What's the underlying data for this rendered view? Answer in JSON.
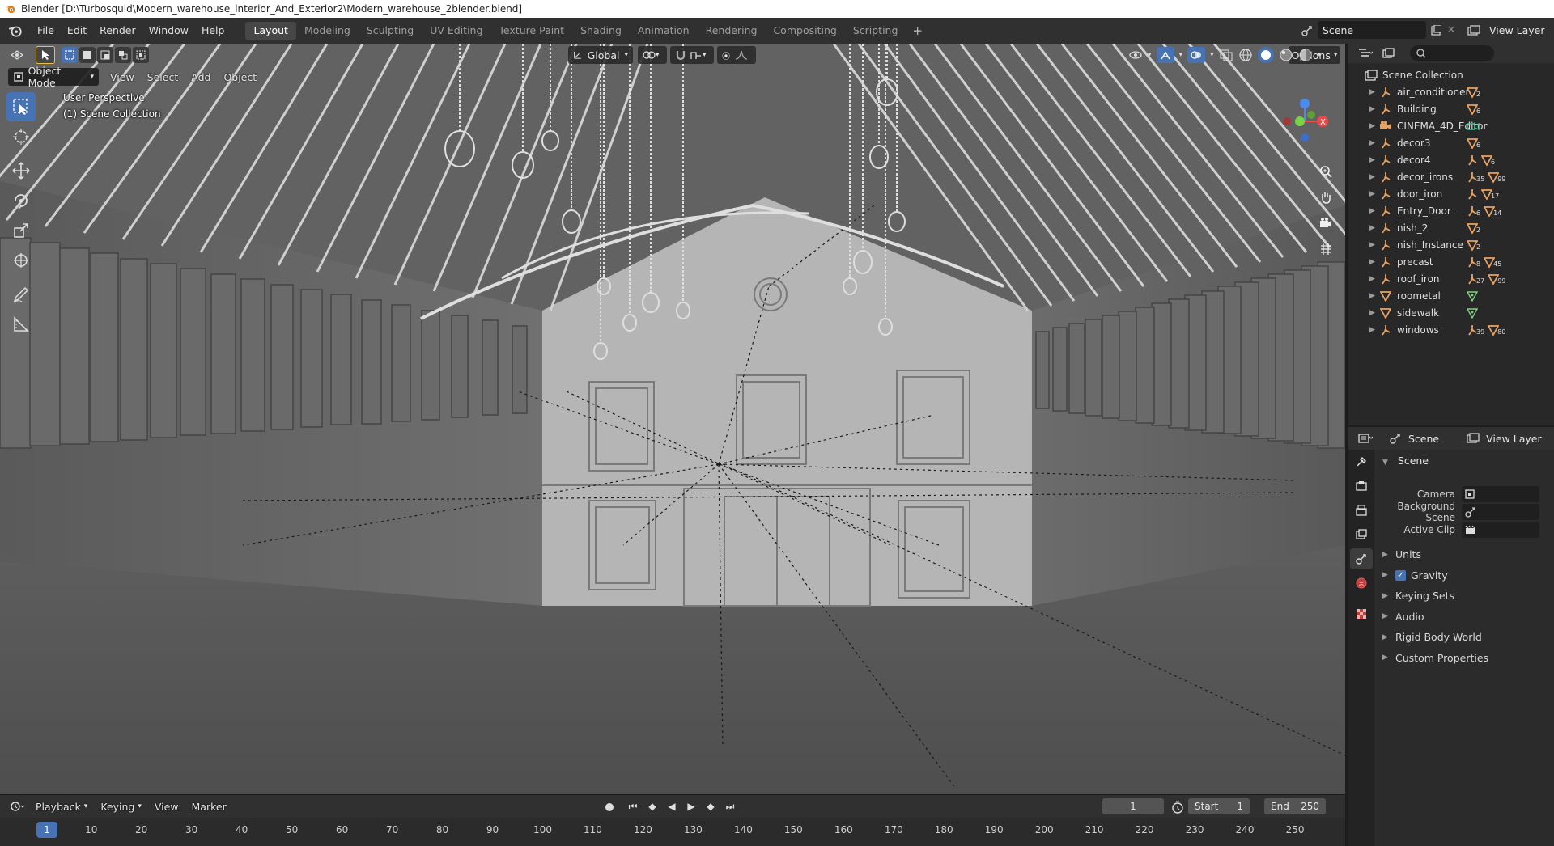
{
  "window": {
    "title": "Blender [D:\\Turbosquid\\Modern_warehouse_interior_And_Exterior2\\Modern_warehouse_2blender.blend]"
  },
  "menu": [
    "File",
    "Edit",
    "Render",
    "Window",
    "Help"
  ],
  "workspaces": [
    "Layout",
    "Modeling",
    "Sculpting",
    "UV Editing",
    "Texture Paint",
    "Shading",
    "Animation",
    "Rendering",
    "Compositing",
    "Scripting"
  ],
  "active_workspace": "Layout",
  "topbar": {
    "scene": "Scene",
    "view_layer": "View Layer"
  },
  "viewport": {
    "mode": "Object Mode",
    "menus": [
      "View",
      "Select",
      "Add",
      "Object"
    ],
    "orientation": "Global",
    "options_label": "Options",
    "perspective_label": "User Perspective",
    "collection_label": "(1) Scene Collection"
  },
  "timeline": {
    "menus": [
      "Playback",
      "Keying",
      "View",
      "Marker"
    ],
    "current_frame": "1",
    "frame_field": "1",
    "start_label": "Start",
    "start_value": "1",
    "end_label": "End",
    "end_value": "250",
    "ticks": [
      "1",
      "10",
      "20",
      "30",
      "40",
      "50",
      "60",
      "70",
      "80",
      "90",
      "100",
      "110",
      "120",
      "130",
      "140",
      "150",
      "160",
      "170",
      "180",
      "190",
      "200",
      "210",
      "220",
      "230",
      "240",
      "250"
    ]
  },
  "outliner": {
    "root": "Scene Collection",
    "items": [
      {
        "name": "air_conditioner",
        "type": "empty",
        "badges": [
          {
            "kind": "mesh",
            "count": "2"
          }
        ]
      },
      {
        "name": "Building",
        "type": "empty",
        "badges": [
          {
            "kind": "mesh",
            "count": "6"
          }
        ]
      },
      {
        "name": "CINEMA_4D_Editor",
        "type": "camera",
        "badges": [
          {
            "kind": "camera-data",
            "count": ""
          }
        ]
      },
      {
        "name": "decor3",
        "type": "empty",
        "badges": [
          {
            "kind": "mesh",
            "count": "6"
          }
        ]
      },
      {
        "name": "decor4",
        "type": "empty",
        "badges": [
          {
            "kind": "empty",
            "count": ""
          },
          {
            "kind": "mesh",
            "count": "6"
          }
        ]
      },
      {
        "name": "decor_irons",
        "type": "empty",
        "badges": [
          {
            "kind": "empty",
            "count": "35"
          },
          {
            "kind": "mesh",
            "count": "99"
          }
        ]
      },
      {
        "name": "door_iron",
        "type": "empty",
        "badges": [
          {
            "kind": "empty",
            "count": ""
          },
          {
            "kind": "mesh",
            "count": "17"
          }
        ]
      },
      {
        "name": "Entry_Door",
        "type": "empty",
        "badges": [
          {
            "kind": "empty",
            "count": "6"
          },
          {
            "kind": "mesh",
            "count": "14"
          }
        ]
      },
      {
        "name": "nish_2",
        "type": "empty",
        "badges": [
          {
            "kind": "mesh",
            "count": "2"
          }
        ]
      },
      {
        "name": "nish_Instance",
        "type": "empty",
        "badges": [
          {
            "kind": "mesh",
            "count": "2"
          }
        ]
      },
      {
        "name": "precast",
        "type": "empty",
        "badges": [
          {
            "kind": "empty",
            "count": "8"
          },
          {
            "kind": "mesh",
            "count": "45"
          }
        ]
      },
      {
        "name": "roof_iron",
        "type": "empty",
        "badges": [
          {
            "kind": "empty",
            "count": "27"
          },
          {
            "kind": "mesh",
            "count": "99"
          }
        ]
      },
      {
        "name": "roometal",
        "type": "mesh",
        "badges": [
          {
            "kind": "mesh-data",
            "count": ""
          }
        ]
      },
      {
        "name": "sidewalk",
        "type": "mesh",
        "badges": [
          {
            "kind": "mesh-data",
            "count": ""
          }
        ]
      },
      {
        "name": "windows",
        "type": "empty",
        "badges": [
          {
            "kind": "empty",
            "count": "39"
          },
          {
            "kind": "mesh",
            "count": "80"
          }
        ]
      }
    ]
  },
  "properties": {
    "header_scene": "Scene",
    "header_view_layer": "View Layer",
    "panel_title": "Scene",
    "fields": [
      {
        "label": "Camera"
      },
      {
        "label": "Background Scene"
      },
      {
        "label": "Active Clip"
      }
    ],
    "subpanels": [
      {
        "label": "Units",
        "checkbox": false
      },
      {
        "label": "Gravity",
        "checkbox": true
      },
      {
        "label": "Keying Sets",
        "checkbox": false
      },
      {
        "label": "Audio",
        "checkbox": false
      },
      {
        "label": "Rigid Body World",
        "checkbox": false
      },
      {
        "label": "Custom Properties",
        "checkbox": false
      }
    ]
  },
  "colors": {
    "accent": "#4772b3",
    "empty_icon": "#e8a264",
    "mesh_icon": "#e8a264",
    "mesh_data_icon": "#7cd27c",
    "axis_x": "#e74b4b",
    "axis_y": "#7bd348",
    "axis_z": "#4a8bf0"
  }
}
